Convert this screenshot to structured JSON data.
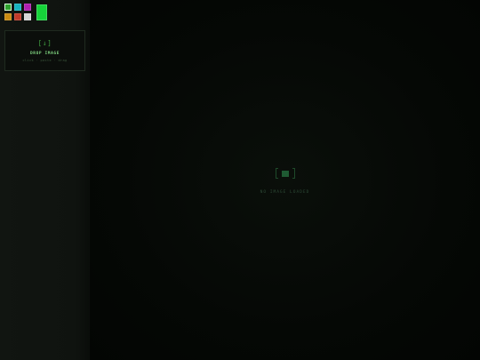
{
  "palette": {
    "swatches": [
      {
        "name": "green",
        "color": "#2ea02e",
        "active": true
      },
      {
        "name": "cyan",
        "color": "#17b3bf"
      },
      {
        "name": "magenta",
        "color": "#b01fb0"
      },
      {
        "name": "amber",
        "color": "#c98a12"
      },
      {
        "name": "red",
        "color": "#c23a2a"
      },
      {
        "name": "white",
        "color": "#d6d6d6"
      }
    ],
    "current_color": "#16d43a"
  },
  "dropzone": {
    "icon": "[↓]",
    "title": "DROP IMAGE",
    "hint": "click · paste · drag"
  },
  "canvas": {
    "empty_text": "NO IMAGE LOADED"
  }
}
